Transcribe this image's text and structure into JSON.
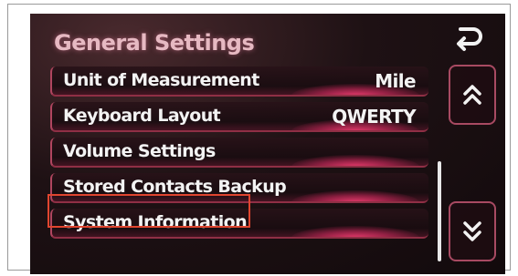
{
  "screen": {
    "title": "General Settings"
  },
  "menu": {
    "items": [
      {
        "label": "Unit of Measurement",
        "value": "Mile"
      },
      {
        "label": "Keyboard Layout",
        "value": "QWERTY"
      },
      {
        "label": "Volume Settings",
        "value": ""
      },
      {
        "label": "Stored Contacts Backup",
        "value": ""
      },
      {
        "label": "System Information",
        "value": ""
      }
    ],
    "highlighted_item": "System Information"
  },
  "controls": {
    "back_icon": "back-arrow-icon",
    "scroll_up_icon": "double-chevron-up-icon",
    "scroll_down_icon": "double-chevron-down-icon"
  },
  "colors": {
    "highlight_box": "#e0452f",
    "row_accent": "#b0455f",
    "glow": "#eb3c6e"
  }
}
